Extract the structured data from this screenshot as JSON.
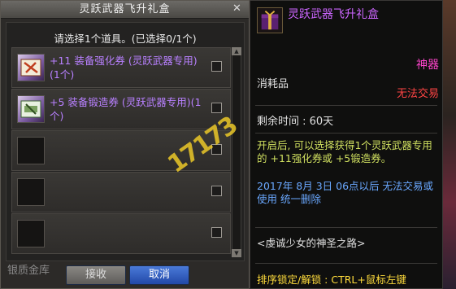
{
  "dialog": {
    "title": "灵跃武器飞升礼盒",
    "close_label": "✕",
    "prompt": "请选择1个道具。(已选择0/1个)",
    "items": [
      {
        "text": "+11 装备强化券 (灵跃武器专用)(1个)",
        "icon": "enhance-ticket-icon"
      },
      {
        "text": "+5 装备锻造券 (灵跃武器专用)(1个)",
        "icon": "forge-ticket-icon"
      }
    ],
    "empty_slots": 3,
    "bank_label": "银质金库",
    "receive_button": "接收",
    "cancel_button": "取消"
  },
  "tooltip": {
    "item_name": "灵跃武器飞升礼盒",
    "grade": "神器",
    "trade": "无法交易",
    "type": "消耗品",
    "remaining": "剩余时间 : 60天",
    "description": "开启后, 可以选择获得1个灵跃武器专用的 +11强化券或 +5锻造券。",
    "expire": "2017年 8月 3日 06点以后 无法交易或使用 统一删除",
    "quote": "<虔诚少女的神圣之路>",
    "lock_hint": "排序锁定/解锁 : CTRL+鼠标左键"
  },
  "watermark": "17173",
  "colors": {
    "item_purple": "#b880ff",
    "grade_pink": "#ff44cc",
    "trade_red": "#ff4444",
    "desc_yellow": "#d0e060",
    "expire_blue": "#6aa8ff",
    "hint_yellow": "#ffdc3c",
    "cancel_blue": "#2f5cc0"
  }
}
